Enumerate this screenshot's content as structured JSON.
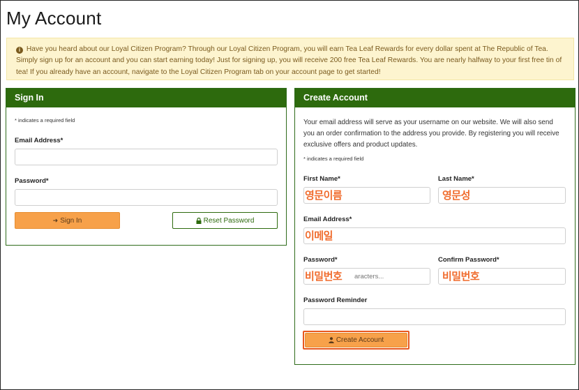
{
  "page": {
    "title": "My Account"
  },
  "notice": {
    "icon": "info-circle-icon",
    "text": "Have you heard about our Loyal Citizen Program? Through our Loyal Citizen Program, you will earn Tea Leaf Rewards for every dollar spent at The Republic of Tea. Simply sign up for an account and you can start earning today! Just for signing up, you will receive 200 free Tea Leaf Rewards. You are nearly halfway to your first free tin of tea! If you already have an account, navigate to the Loyal Citizen Program tab on your account page to get started!"
  },
  "signin": {
    "title": "Sign In",
    "required_note": "* indicates a required field",
    "email_label": "Email Address*",
    "email_value": "",
    "password_label": "Password*",
    "password_value": "",
    "sign_in_button": "Sign In",
    "sign_in_icon": "sign-in-arrow-icon",
    "reset_button": "Reset Password",
    "reset_icon": "lock-icon"
  },
  "create": {
    "title": "Create Account",
    "intro": "Your email address will serve as your username on our website. We will also send you an order confirmation to the address you provide. By registering you will receive exclusive offers and product updates.",
    "required_note": "* indicates a required field",
    "first_name_label": "First Name*",
    "last_name_label": "Last Name*",
    "email_label": "Email Address*",
    "password_label": "Password*",
    "password_placeholder": "aracters...",
    "confirm_password_label": "Confirm Password*",
    "reminder_label": "Password Reminder",
    "create_button": "Create Account",
    "create_icon": "user-icon"
  },
  "annotations": {
    "first_name": "영문이름",
    "last_name": "영문성",
    "email": "이메일",
    "password": "비밀번호",
    "confirm_password": "비밀번호"
  },
  "colors": {
    "panel_header": "#2d6a0d",
    "primary_button": "#f7a14a",
    "notice_bg": "#fdf4cf",
    "annotation": "#f06b2c"
  }
}
